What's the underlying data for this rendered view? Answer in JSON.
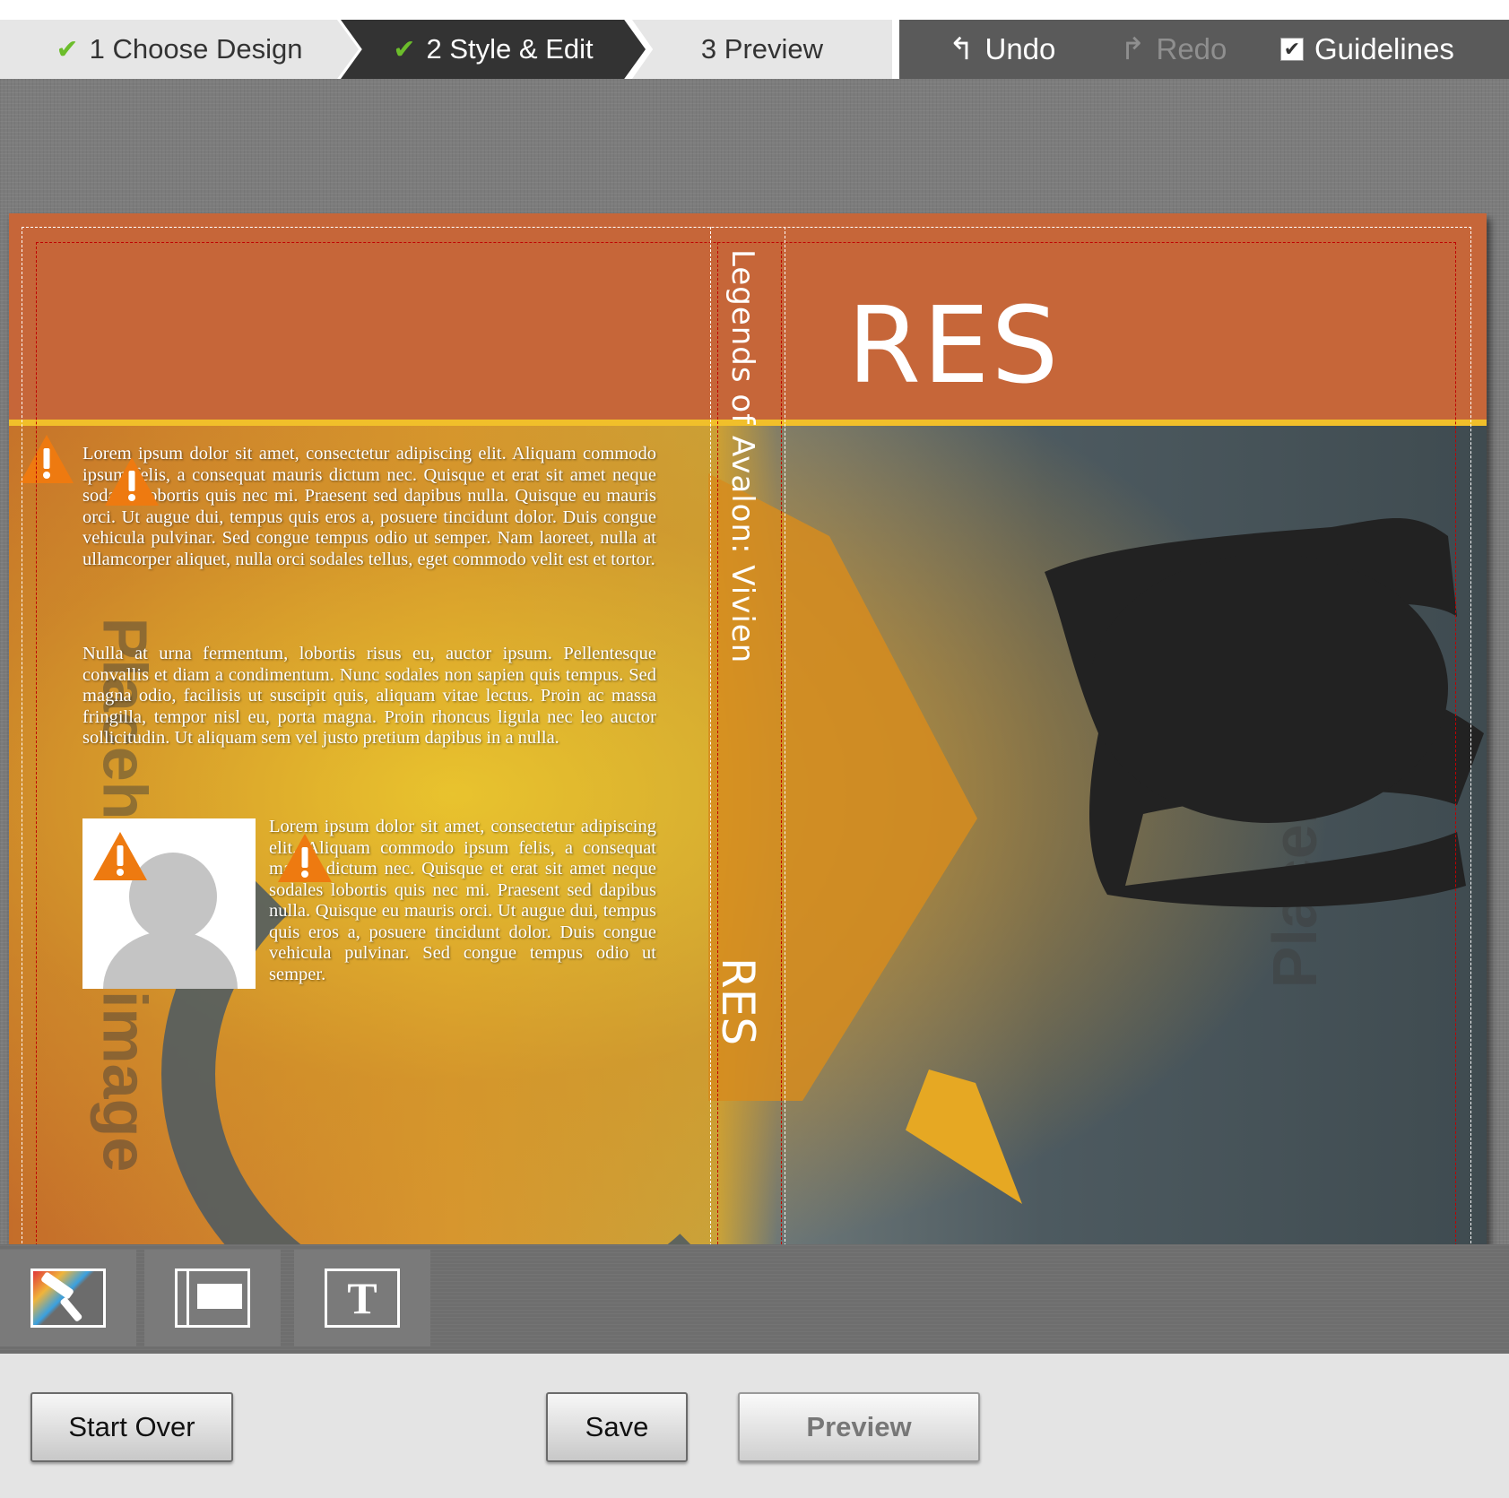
{
  "steps": [
    {
      "number": "1",
      "label": "Choose Design",
      "done": true
    },
    {
      "number": "2",
      "label": "Style & Edit",
      "done": true,
      "active": true
    },
    {
      "number": "3",
      "label": "Preview",
      "done": false
    }
  ],
  "toolbar": {
    "undo_label": "Undo",
    "redo_label": "Redo",
    "guidelines_label": "Guidelines",
    "guidelines_checked": true,
    "undo_icon": "undo-arrow-icon",
    "redo_icon": "redo-arrow-icon"
  },
  "cover": {
    "header_color": "#c66639",
    "accent_line_color": "#f1bf2a",
    "front_title": "RES",
    "spine_title": "Legends of Avalon: Vivien",
    "spine_short": "RES",
    "watermark_back": "Placeholder image",
    "watermark_front": "Placeho",
    "back_paragraph_1": "Lorem ipsum dolor sit amet, consectetur adipiscing elit. Aliquam commodo ipsum felis, a consequat mauris dictum nec. Quisque et erat sit amet neque sodales lobortis quis nec mi. Praesent sed dapibus nulla. Quisque eu mauris orci. Ut augue dui, tempus quis eros a, posuere tincidunt dolor. Duis congue vehicula pulvinar. Sed congue tempus odio ut semper. Nam laoreet, nulla at ullamcorper aliquet, nulla orci sodales tellus, eget commodo velit est et tortor.",
    "back_paragraph_2": "Nulla at urna fermentum, lobortis risus eu, auctor ipsum. Pellentesque convallis et diam a condimentum. Nunc sodales non sapien quis tempus. Sed magna odio, facilisis ut suscipit quis, aliquam vitae lectus. Proin ac massa fringilla, tempor nisl eu, porta magna. Proin rhoncus ligula nec leo auctor sollicitudin. Ut aliquam sem vel justo pretium dapibus in a nulla.",
    "author_bio": "Lorem ipsum dolor sit amet, consectetur adipiscing elit. Aliquam commodo ipsum felis, a consequat mauris dictum nec. Quisque et erat sit amet neque sodales lobortis quis nec mi. Praesent sed dapibus nulla. Quisque eu mauris orci. Ut augue dui, tempus quis eros a, posuere tincidunt dolor. Duis congue vehicula pulvinar. Sed congue tempus odio ut semper.",
    "warning_icon": "warning-triangle-icon",
    "author_photo_icon": "avatar-placeholder-icon"
  },
  "tools": [
    {
      "name": "color-tool",
      "icon": "paint-roller-icon"
    },
    {
      "name": "layout-tool",
      "icon": "layout-icon"
    },
    {
      "name": "text-tool",
      "icon": "text-icon",
      "glyph": "T"
    }
  ],
  "actions": {
    "start_over_label": "Start Over",
    "save_label": "Save",
    "preview_label": "Preview"
  }
}
